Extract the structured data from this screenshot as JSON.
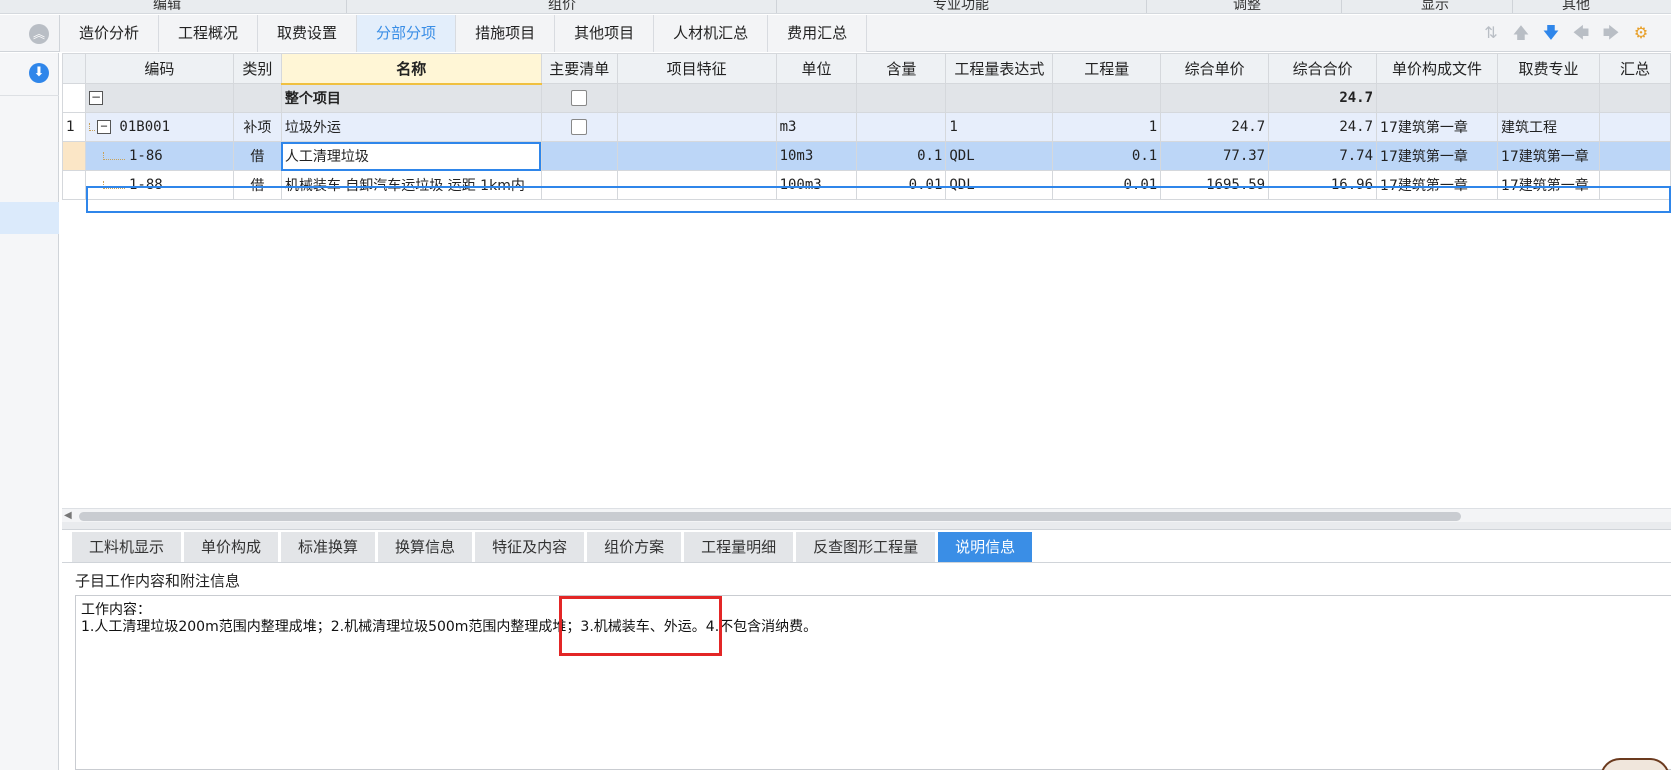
{
  "ribbon_groups": [
    {
      "label": "编辑"
    },
    {
      "label": "组价"
    },
    {
      "label": "专业功能"
    },
    {
      "label": "调整"
    },
    {
      "label": "显示"
    },
    {
      "label": "其他"
    }
  ],
  "tabs": [
    {
      "label": "造价分析",
      "active": false
    },
    {
      "label": "工程概况",
      "active": false
    },
    {
      "label": "取费设置",
      "active": false
    },
    {
      "label": "分部分项",
      "active": true
    },
    {
      "label": "措施项目",
      "active": false
    },
    {
      "label": "其他项目",
      "active": false
    },
    {
      "label": "人材机汇总",
      "active": false
    },
    {
      "label": "费用汇总",
      "active": false
    }
  ],
  "toolbar_icons": [
    "sort-icon",
    "arrow-up-icon",
    "arrow-down-icon",
    "arrow-left-icon",
    "arrow-right-icon",
    "settings-icon"
  ],
  "grid": {
    "columns": [
      "编码",
      "类别",
      "名称",
      "主要清单",
      "项目特征",
      "单位",
      "含量",
      "工程量表达式",
      "工程量",
      "综合单价",
      "综合合价",
      "单价构成文件",
      "取费专业",
      "汇总"
    ],
    "rows": [
      {
        "rownum": "",
        "code": "",
        "category": "",
        "name": "整个项目",
        "main_list": "",
        "feature": "",
        "unit": "",
        "content": "",
        "expr": "",
        "qty": "",
        "unit_price": "",
        "total": "24.7",
        "file": "",
        "specialty": "",
        "type": "group"
      },
      {
        "rownum": "1",
        "code": "01B001",
        "category": "补项",
        "name": "垃圾外运",
        "main_list": "",
        "feature": "",
        "unit": "m3",
        "content": "",
        "expr": "1",
        "qty": "1",
        "unit_price": "24.7",
        "total": "24.7",
        "file": "17建筑第一章",
        "specialty": "建筑工程",
        "type": "item"
      },
      {
        "rownum": "",
        "code": "1-86",
        "category": "借",
        "name": "人工清理垃圾",
        "main_list": "",
        "feature": "",
        "unit": "10m3",
        "content": "0.1",
        "expr": "QDL",
        "qty": "0.1",
        "unit_price": "77.37",
        "total": "7.74",
        "file": "17建筑第一章",
        "specialty": "17建筑第一章",
        "type": "sel"
      },
      {
        "rownum": "",
        "code": "1-88",
        "category": "借",
        "name": "机械装车 自卸汽车运垃圾 运距 1km内",
        "main_list": "",
        "feature": "",
        "unit": "100m3",
        "content": "0.01",
        "expr": "QDL",
        "qty": "0.01",
        "unit_price": "1695.59",
        "total": "16.96",
        "file": "17建筑第一章",
        "specialty": "17建筑第一章",
        "type": "plain"
      }
    ]
  },
  "bottom_tabs": [
    {
      "label": "工料机显示",
      "active": false
    },
    {
      "label": "单价构成",
      "active": false
    },
    {
      "label": "标准换算",
      "active": false
    },
    {
      "label": "换算信息",
      "active": false
    },
    {
      "label": "特征及内容",
      "active": false
    },
    {
      "label": "组价方案",
      "active": false
    },
    {
      "label": "工程量明细",
      "active": false
    },
    {
      "label": "反查图形工程量",
      "active": false
    },
    {
      "label": "说明信息",
      "active": true
    }
  ],
  "description": {
    "title": "子目工作内容和附注信息",
    "line1": "工作内容：",
    "line2": "1.人工清理垃圾200m范围内整理成堆；2.机械清理垃圾500m范围内整理成堆；3.机械装车、外运。4.不包含消纳费。"
  },
  "colors": {
    "accent": "#3a8ee6",
    "highlight": "#e32626",
    "selected_row": "#bcd6f7"
  }
}
